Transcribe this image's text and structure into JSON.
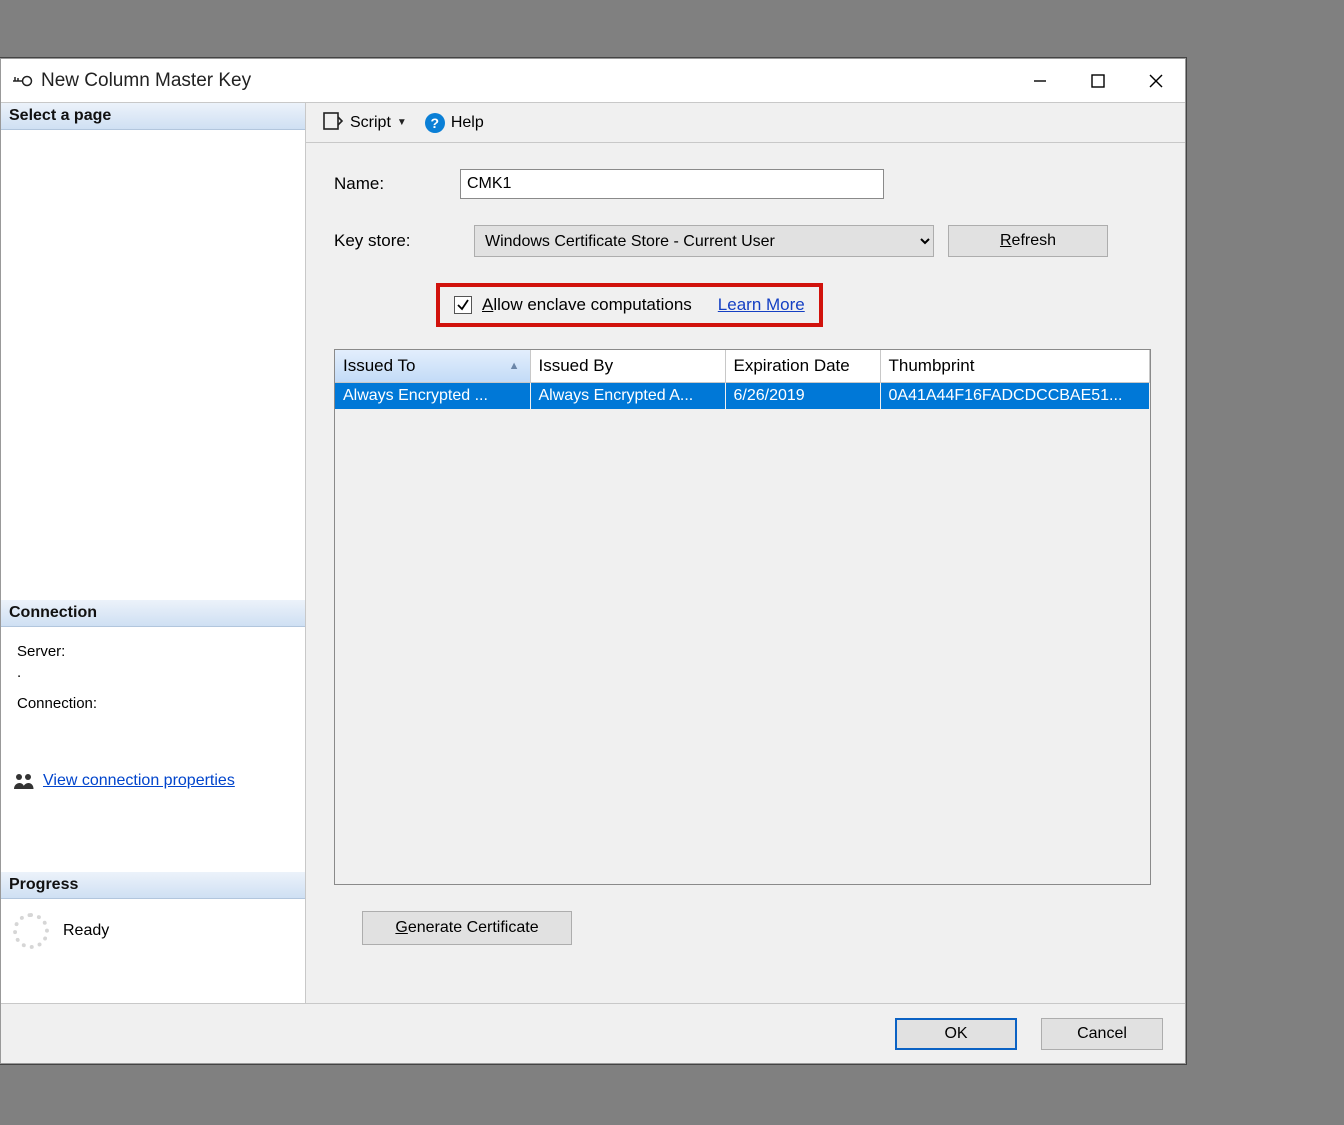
{
  "window": {
    "title": "New Column Master Key"
  },
  "left": {
    "select_page": "Select a page",
    "connection_head": "Connection",
    "server_label": "Server:",
    "server_value": ".",
    "connection_label": "Connection:",
    "view_props": "View connection properties",
    "progress_head": "Progress",
    "progress_status": "Ready"
  },
  "toolbar": {
    "script": "Script",
    "help": "Help"
  },
  "form": {
    "name_label": "Name:",
    "name_value": "CMK1",
    "keystore_label": "Key store:",
    "keystore_value": "Windows Certificate Store - Current User",
    "refresh": "Refresh",
    "allow_enclave": "Allow enclave computations",
    "learn_more": "Learn More",
    "generate": "Generate Certificate"
  },
  "grid": {
    "cols": {
      "c0": "Issued To",
      "c1": "Issued By",
      "c2": "Expiration Date",
      "c3": "Thumbprint"
    },
    "row": {
      "c0": "Always Encrypted ...",
      "c1": "Always Encrypted A...",
      "c2": "6/26/2019",
      "c3": "0A41A44F16FADCDCCBAE51..."
    }
  },
  "footer": {
    "ok": "OK",
    "cancel": "Cancel"
  }
}
